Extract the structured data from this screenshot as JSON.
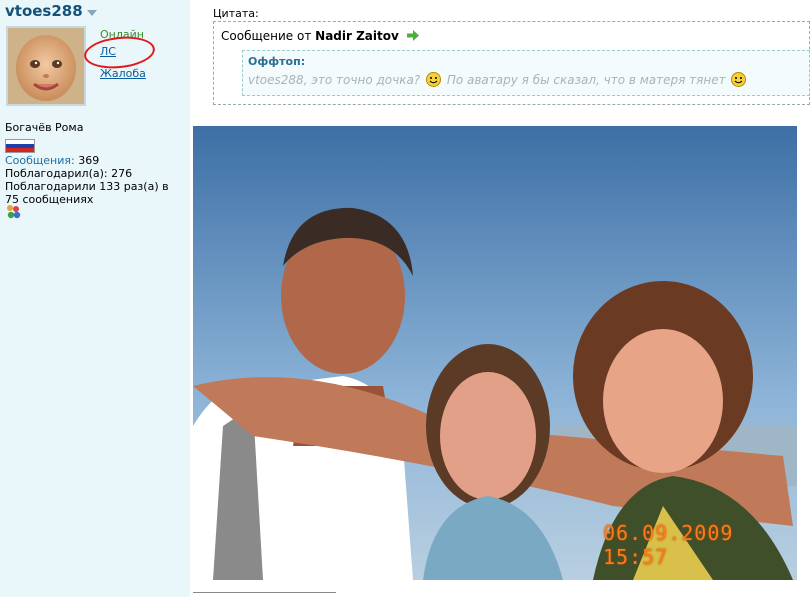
{
  "user": {
    "username": "vtoes288",
    "status": "Онлайн",
    "pm_link": "ЛС",
    "report_link": "Жалоба",
    "real_name": "Богачёв Рома",
    "posts_label": "Сообщения:",
    "posts_value": "369",
    "thanked_line": "Поблагодарил(а): 276",
    "thanks_received_line": "Поблагодарили 133 раз(а) в 75 сообщениях",
    "flag_colors": [
      "#ffffff",
      "#1c3fa8",
      "#d5251f"
    ]
  },
  "quote": {
    "label": "Цитата:",
    "header_prefix": "Сообщение от",
    "author": "Nadir Zaitov",
    "offtop_title": "Оффтоп:",
    "offtop_text_1": "vtoes288, это точно дочка?",
    "offtop_text_2": "По аватару я бы сказал, что в матеря тянет"
  },
  "photo": {
    "timestamp": "06.09.2009 15:57"
  },
  "colors": {
    "sidebar_bg": "#e9f7fb",
    "username": "#14527a",
    "link": "#0a5b9c",
    "online": "#3c8a2e",
    "annotation_circle": "#e01a1a",
    "timestamp": "#ff7a18"
  }
}
